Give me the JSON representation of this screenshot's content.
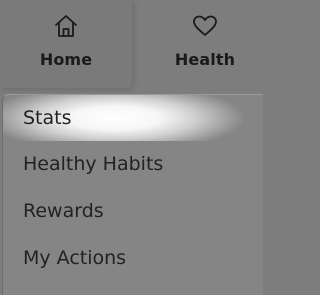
{
  "nav": {
    "tabs": [
      {
        "label": "Home",
        "icon": "home-icon"
      },
      {
        "label": "Health",
        "icon": "heart-icon"
      }
    ]
  },
  "menu": {
    "items": [
      {
        "label": "Stats"
      },
      {
        "label": "Healthy Habits"
      },
      {
        "label": "Rewards"
      },
      {
        "label": "My Actions"
      }
    ]
  }
}
